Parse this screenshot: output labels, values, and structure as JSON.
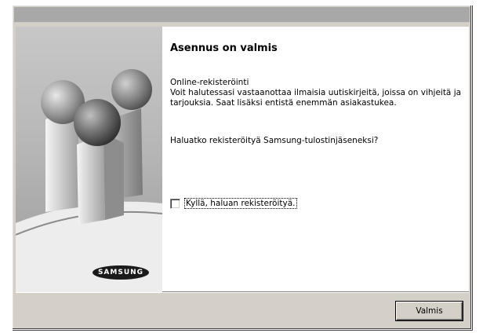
{
  "dialog": {
    "heading": "Asennus on valmis",
    "section_title": "Online-rekisteröinti",
    "description": "Voit halutessasi vastaanottaa ilmaisia uutiskirjeitä, joissa on vihjeitä ja tarjouksia. Saat lisäksi entistä enemmän asiakastukea.",
    "question": "Haluatko rekisteröityä Samsung-tulostinjäseneksi?",
    "checkbox_label": "Kyllä, haluan rekisteröityä.",
    "checkbox_checked": false,
    "finish_button": "Valmis"
  },
  "branding": {
    "logo_text": "SAMSUNG",
    "logo_color": "#1a1a1a"
  },
  "colors": {
    "dialog_face": "#d4d0c8",
    "titlebar": "#a8a8a8",
    "content_bg": "#ffffff"
  }
}
